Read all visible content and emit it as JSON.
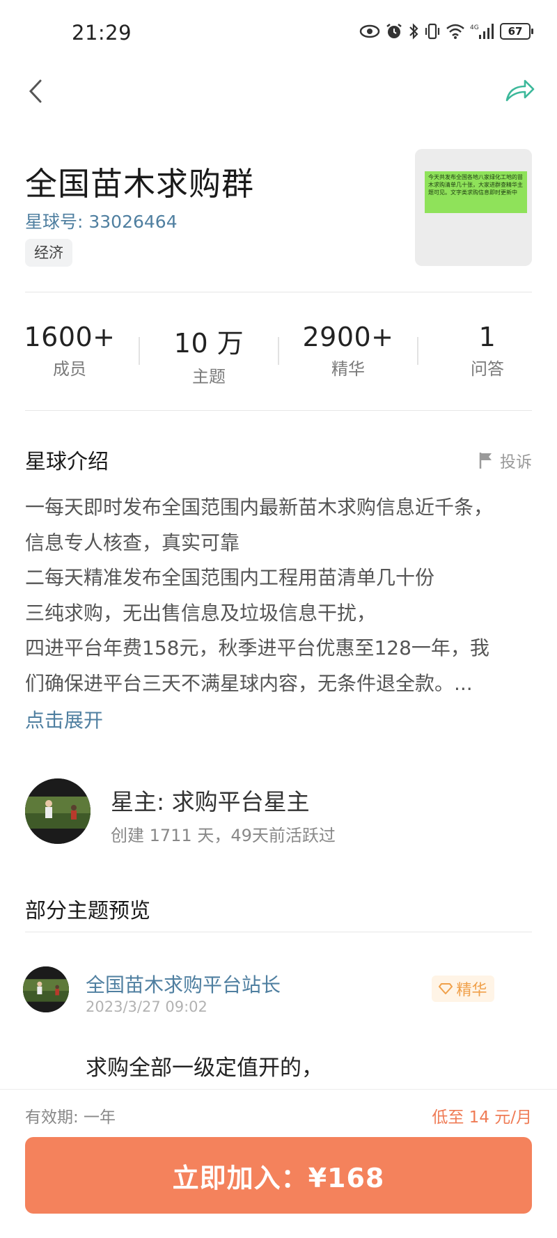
{
  "status_bar": {
    "time": "21:29",
    "battery": "67",
    "network": "4G"
  },
  "nav": {
    "back_icon": "chevron-left-icon",
    "share_icon": "share-arrow-icon"
  },
  "group": {
    "title": "全国苗木求购群",
    "planet_id": "星球号: 33026464",
    "tag": "经济",
    "cover_note": "今天共发布全国各地八家绿化工地的苗木求购清单几十张，大家进群查精华主题可见。文字类求购信息即时更新中"
  },
  "stats": [
    {
      "value": "1600+",
      "label": "成员"
    },
    {
      "value": "10 万",
      "label": "主题"
    },
    {
      "value": "2900+",
      "label": "精华"
    },
    {
      "value": "1",
      "label": "问答"
    }
  ],
  "intro": {
    "title": "星球介绍",
    "report_label": "投诉",
    "lines": [
      "一每天即时发布全国范围内最新苗木求购信息近千条，",
      "信息专人核查，真实可靠",
      "二每天精准发布全国范围内工程用苗清单几十份",
      "三纯求购，无出售信息及垃圾信息干扰，",
      "四进平台年费158元，秋季进平台优惠至128一年，我",
      "们确保进平台三天不满星球内容，无条件退全款。..."
    ],
    "expand_label": "点击展开"
  },
  "owner": {
    "name": "星主: 求购平台星主",
    "meta": "创建 1711 天，49天前活跃过"
  },
  "preview": {
    "title": "部分主题预览",
    "post": {
      "author": "全国苗木求购平台站长",
      "time": "2023/3/27 09:02",
      "badge": "精华",
      "body": "求购全部一级定值开的，"
    }
  },
  "footer": {
    "validity": "有效期: 一年",
    "price_month": "低至 14 元/月",
    "join_label": "立即加入：¥168"
  },
  "colors": {
    "accent_blue": "#4f7fa0",
    "share_green": "#3cb89a",
    "join_orange": "#f4825c",
    "badge_orange": "#f0a04a"
  }
}
